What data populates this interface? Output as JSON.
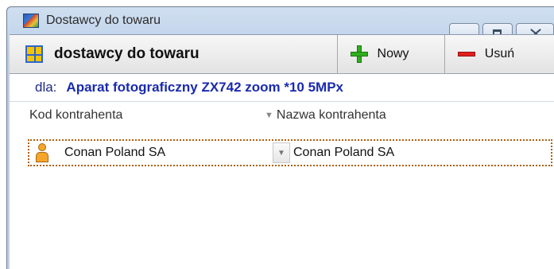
{
  "window": {
    "title": "Dostawcy do towaru",
    "icon": "app-icon"
  },
  "toolbar": {
    "title": "dostawcy do towaru",
    "new_label": "Nowy",
    "delete_label": "Usuń"
  },
  "context": {
    "label": "dla:",
    "value": "Aparat fotograficzny ZX742 zoom *10 5MPx"
  },
  "grid": {
    "columns": [
      "Kod kontrahenta",
      "Nazwa kontrahenta"
    ],
    "rows": [
      {
        "kod": "Conan Poland SA",
        "nazwa": "Conan Poland SA"
      }
    ]
  },
  "colors": {
    "accent_text": "#1a2ab0",
    "add_icon": "#2fae1f",
    "delete_icon": "#e02020",
    "selection_border": "#b06010"
  }
}
